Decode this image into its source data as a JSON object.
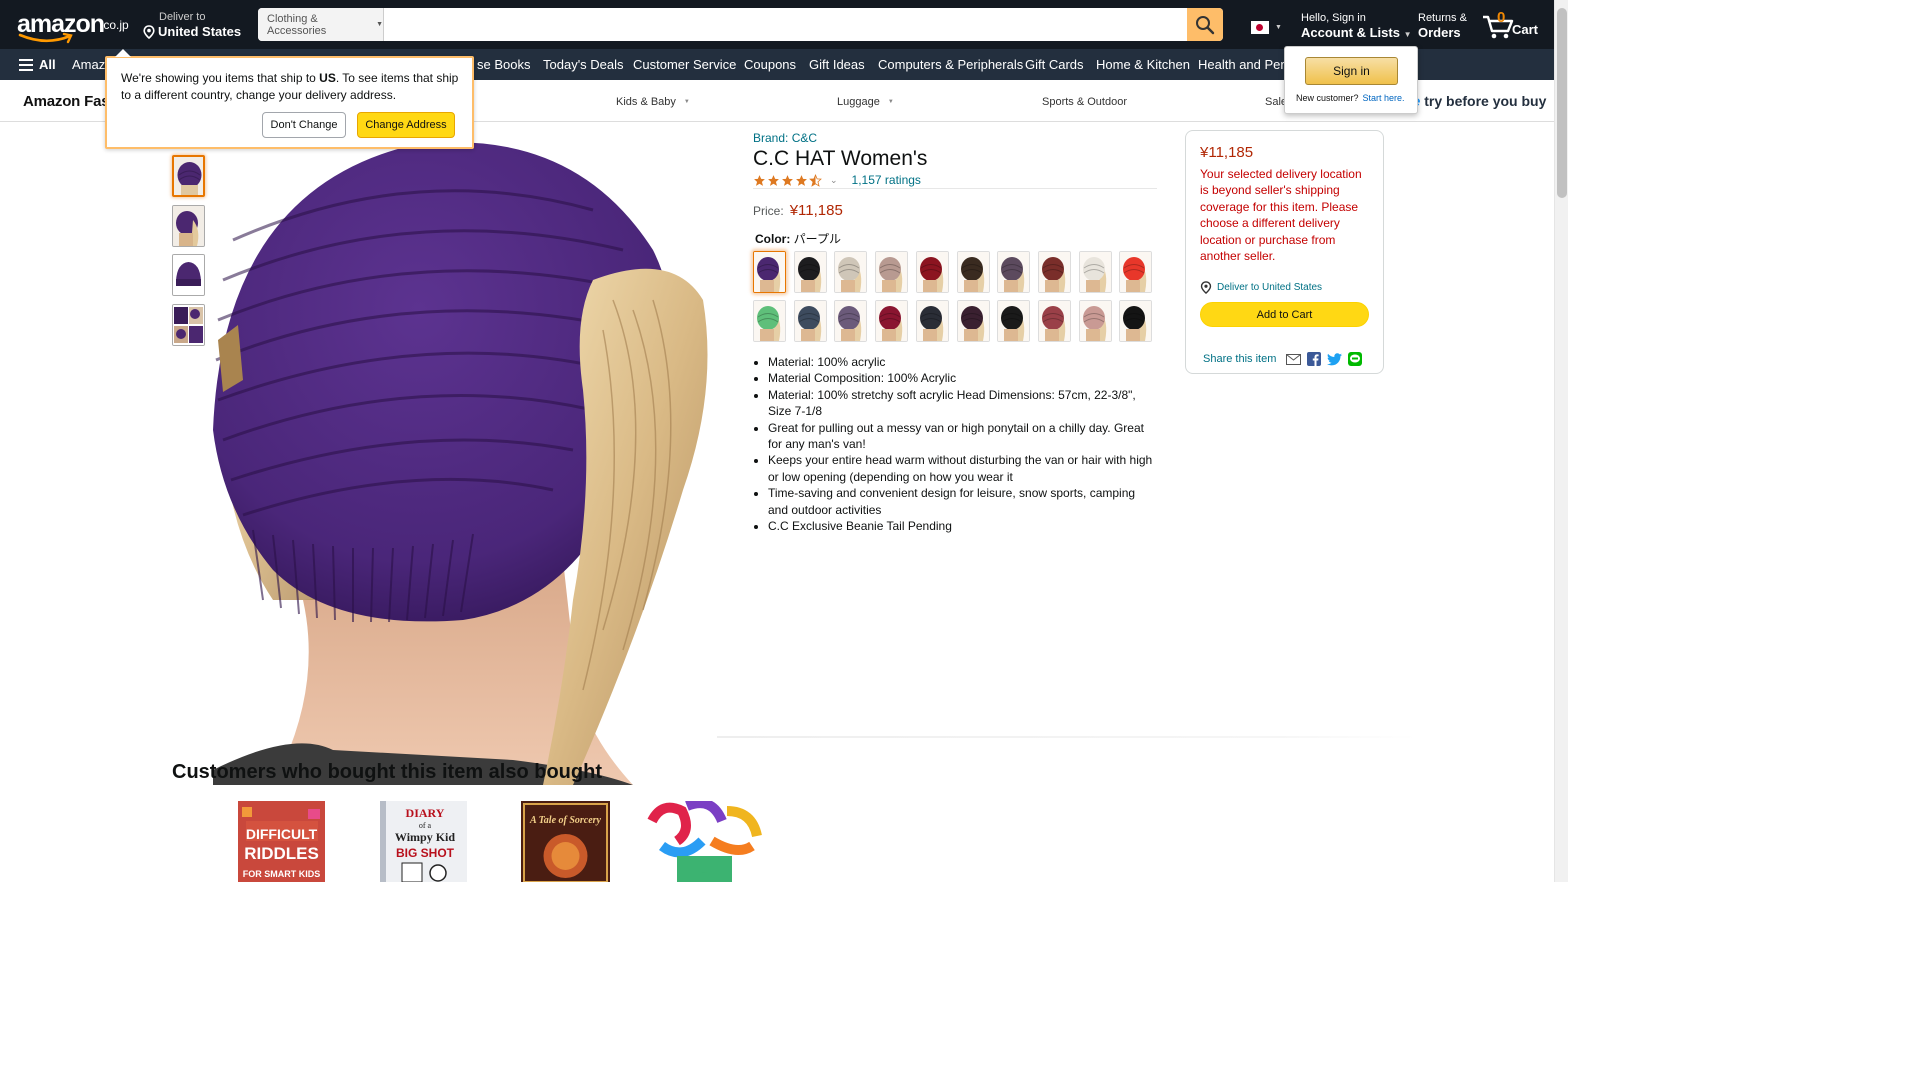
{
  "header": {
    "logo_text": "amazon",
    "logo_tld": ".co.jp",
    "deliver_label": "Deliver to",
    "deliver_location": "United States",
    "search_category": "Clothing & Accessories",
    "search_placeholder": "",
    "account_hello": "Hello, Sign in",
    "account_label": "Account & Lists",
    "returns_label": "Returns &",
    "orders_label": "Orders",
    "cart_count": "0",
    "cart_label": "Cart"
  },
  "subnav": {
    "all_label": "All",
    "items": [
      "Amazon",
      "se Books",
      "Today's Deals",
      "Customer Service",
      "Coupons",
      "Gift Ideas",
      "Computers & Peripherals",
      "Gift Cards",
      "Home & Kitchen",
      "Health and Perso"
    ]
  },
  "fashion_band": {
    "title": "Amazon Fas",
    "items": [
      "Kids & Baby",
      "Luggage",
      "Sports & Outdoor",
      "Sale"
    ],
    "prime_prefix": "ne",
    "prime_text": "try before you buy"
  },
  "address_popover": {
    "message_start": "We're showing you items that ship to ",
    "country": "US",
    "message_end": ". To see items that ship to a different country, change your delivery address.",
    "dont_change": "Don't Change",
    "change_address": "Change Address"
  },
  "signin_popover": {
    "button": "Sign in",
    "new_customer": "New customer?",
    "start_here": "Start here."
  },
  "product": {
    "brand": "Brand: C&C",
    "title": "C.C HAT Women's",
    "rating_stars": 4.5,
    "ratings_count": "1,157 ratings",
    "price_label": "Price:",
    "price": "¥11,185",
    "color_label": "Color:",
    "color_value": "パープル",
    "swatch_colors": [
      "#4b2770",
      "#1d1d1f",
      "#cfc6b8",
      "#b89a91",
      "#8c1420",
      "#3a2b20",
      "#5c4a5e",
      "#7a2e2a",
      "#e8e4dc",
      "#e8372a",
      "#5fbf7a",
      "#3d4b5e",
      "#6b5a7a",
      "#8a1530",
      "#2a2d36",
      "#3a2030",
      "#1a1a1a",
      "#9a4048",
      "#c99a94",
      "#141414"
    ],
    "selected_swatch": 0,
    "bullets": [
      "Material: 100% acrylic",
      "Material Composition: 100% Acrylic",
      "Material: 100% stretchy soft acrylic Head Dimensions: 57cm, 22-3/8\", Size 7-1/8",
      "Great for pulling out a messy van or high ponytail on a chilly day. Great for any man's van!",
      "Keeps your entire head warm without disturbing the van or hair with high or low opening (depending on how you wear it",
      "Time-saving and convenient design for leisure, snow sports, camping and outdoor activities",
      "C.C Exclusive Beanie Tail Pending"
    ]
  },
  "buybox": {
    "price": "¥11,185",
    "warning": "Your selected delivery location is beyond seller's shipping coverage for this item. Please choose a different delivery location or purchase from another seller.",
    "deliver_link": "Deliver to United States",
    "add_to_cart": "Add to Cart",
    "share_label": "Share this item"
  },
  "recommendations": {
    "heading": "Customers who bought this item also bought",
    "items": [
      {
        "line1": "DIFFICULT",
        "line2": "RIDDLES",
        "line3": "FOR SMART KIDS"
      },
      {
        "line1": "DIARY",
        "line2": "of a",
        "line3": "Wimpy Kid",
        "line4": "BIG SHOT"
      },
      {
        "line1": "A Tale of Sorcery"
      },
      {
        "line1": "pop tubes toy"
      }
    ]
  },
  "colors": {
    "nav_dark": "#131921",
    "nav_mid": "#232f3e",
    "accent_orange": "#febd69",
    "price_red": "#b12704",
    "link_teal": "#007185",
    "button_yellow": "#ffd814",
    "product_purple": "#4b2770"
  }
}
